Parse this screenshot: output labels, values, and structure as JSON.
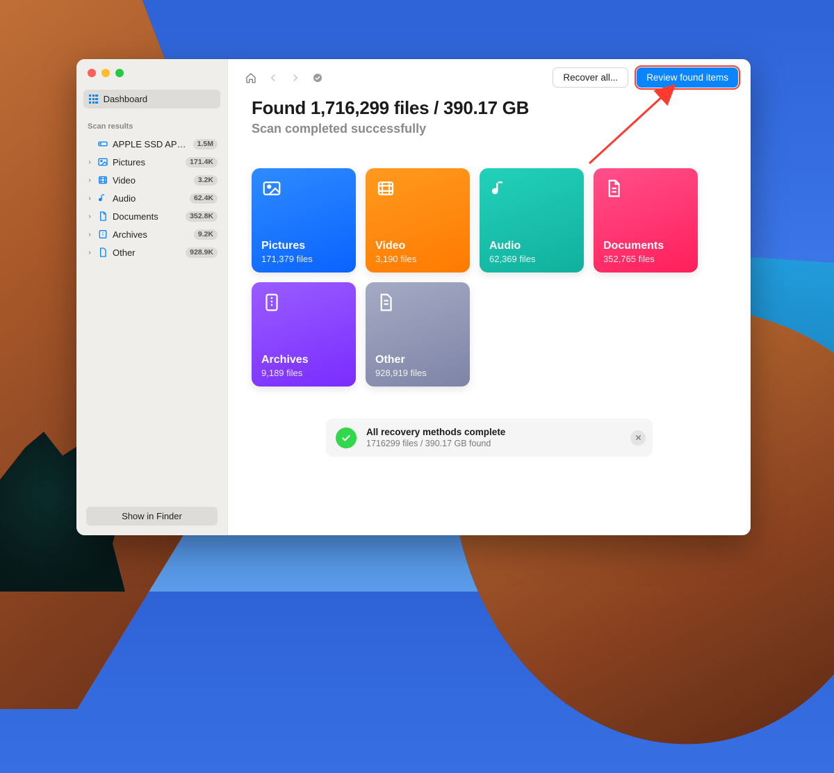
{
  "sidebar": {
    "dashboard_label": "Dashboard",
    "section_title": "Scan results",
    "drive": {
      "label": "APPLE SSD AP0…",
      "badge": "1.5M"
    },
    "items": [
      {
        "label": "Pictures",
        "badge": "171.4K"
      },
      {
        "label": "Video",
        "badge": "3.2K"
      },
      {
        "label": "Audio",
        "badge": "62.4K"
      },
      {
        "label": "Documents",
        "badge": "352.8K"
      },
      {
        "label": "Archives",
        "badge": "9.2K"
      },
      {
        "label": "Other",
        "badge": "928.9K"
      }
    ],
    "finder_button": "Show in Finder"
  },
  "toolbar": {
    "recover_label": "Recover all...",
    "review_label": "Review found items"
  },
  "summary": {
    "headline": "Found 1,716,299 files / 390.17 GB",
    "subhead": "Scan completed successfully"
  },
  "tiles": {
    "pictures": {
      "label": "Pictures",
      "count": "171,379 files"
    },
    "video": {
      "label": "Video",
      "count": "3,190 files"
    },
    "audio": {
      "label": "Audio",
      "count": "62,369 files"
    },
    "documents": {
      "label": "Documents",
      "count": "352,765 files"
    },
    "archives": {
      "label": "Archives",
      "count": "9,189 files"
    },
    "other": {
      "label": "Other",
      "count": "928,919 files"
    }
  },
  "status": {
    "title": "All recovery methods complete",
    "detail": "1716299 files / 390.17 GB found"
  },
  "colors": {
    "accent": "#0a84ff",
    "highlight_outline": "#ff3b30"
  }
}
